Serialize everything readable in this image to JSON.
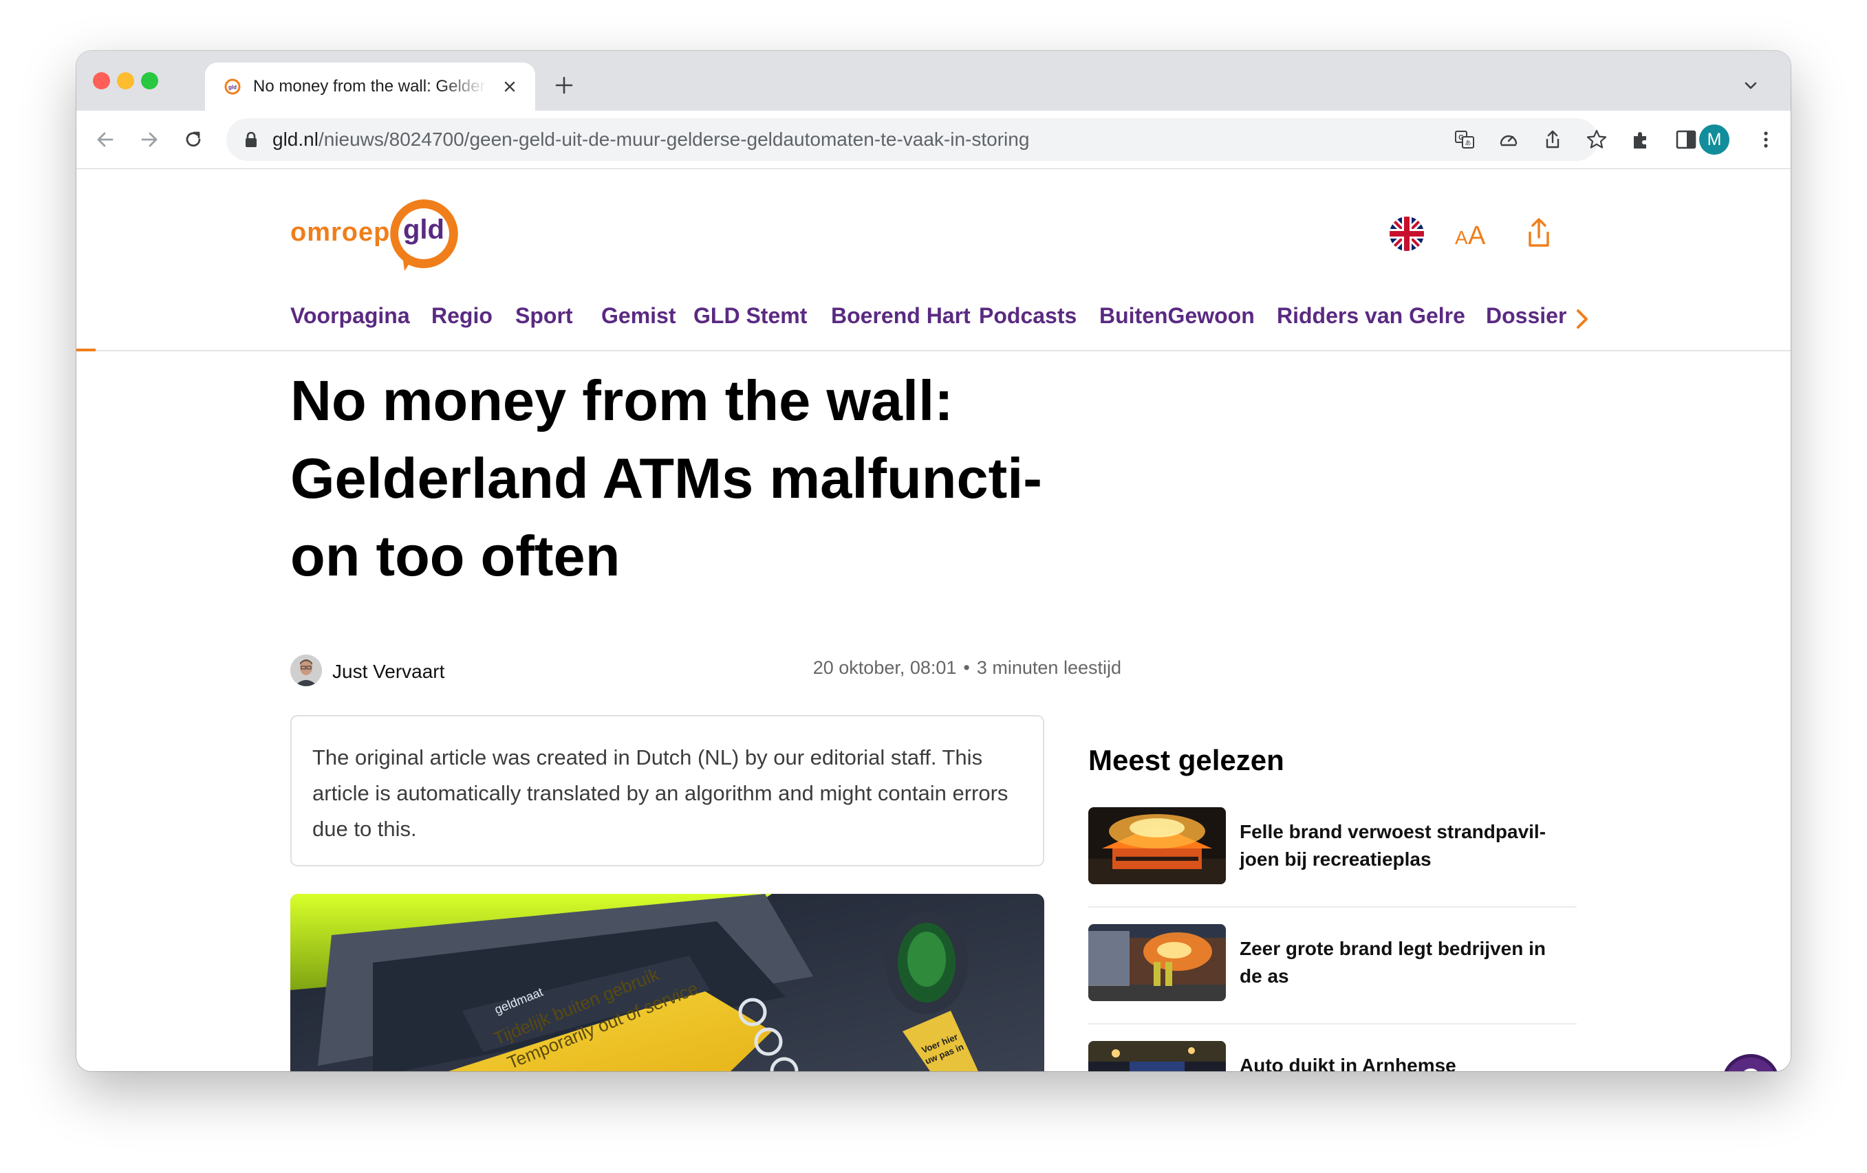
{
  "browser": {
    "tab_title": "No money from the wall: Gelderland ATMs malfunction too often",
    "url_host": "gld.nl",
    "url_path": "/nieuws/8024700/geen-geld-uit-de-muur-gelderse-geldautomaten-te-vaak-in-storing",
    "profile_initial": "M",
    "icons": [
      "back-icon",
      "forward-icon",
      "reload-icon",
      "lock-icon",
      "translate-icon",
      "performance-icon",
      "share-icon",
      "star-icon",
      "extensions-icon",
      "side-panel-icon",
      "menu-icon",
      "tab-search-icon",
      "new-tab-icon",
      "close-icon"
    ]
  },
  "site": {
    "logo_word": "omroep",
    "logo_bubble": "gld",
    "brand_orange": "#f07e1b",
    "brand_purple": "#5a2a82",
    "header_icons": [
      "uk-flag-icon",
      "text-size-icon",
      "share-icon"
    ],
    "text_size_label": "AA",
    "nav": [
      "Voorpagina",
      "Regio",
      "Sport",
      "Gemist",
      "GLD Stemt",
      "Boerend Hart",
      "Podcasts",
      "BuitenGewoon",
      "Ridders van Gelre",
      "Dossier"
    ]
  },
  "article": {
    "headline": "No money from the wall: Gelderland ATMs malfuncti-on too often",
    "author": "Just Vervaart",
    "date": "20 oktober, 08:01",
    "separator": "•",
    "reading_time": "3 minuten leestijd",
    "notice": "The original article was created in Dutch (NL) by our editorial staff. This article is automatically translated by an algorithm and might contain errors due to this.",
    "image_text": {
      "brand": "geldmaat",
      "line1": "Tijdelijk buiten gebruik",
      "line2": "Temporarily out of service",
      "card_label_1": "Voer hier",
      "card_label_2": "uw pas in"
    }
  },
  "sidebar": {
    "title": "Meest gelezen",
    "items": [
      {
        "title": "Felle brand verwoest strandpavil-joen bij recreatieplas"
      },
      {
        "title": "Zeer grote brand legt bedrijven in de as"
      },
      {
        "title": "Auto duikt in Arnhemse"
      }
    ]
  }
}
